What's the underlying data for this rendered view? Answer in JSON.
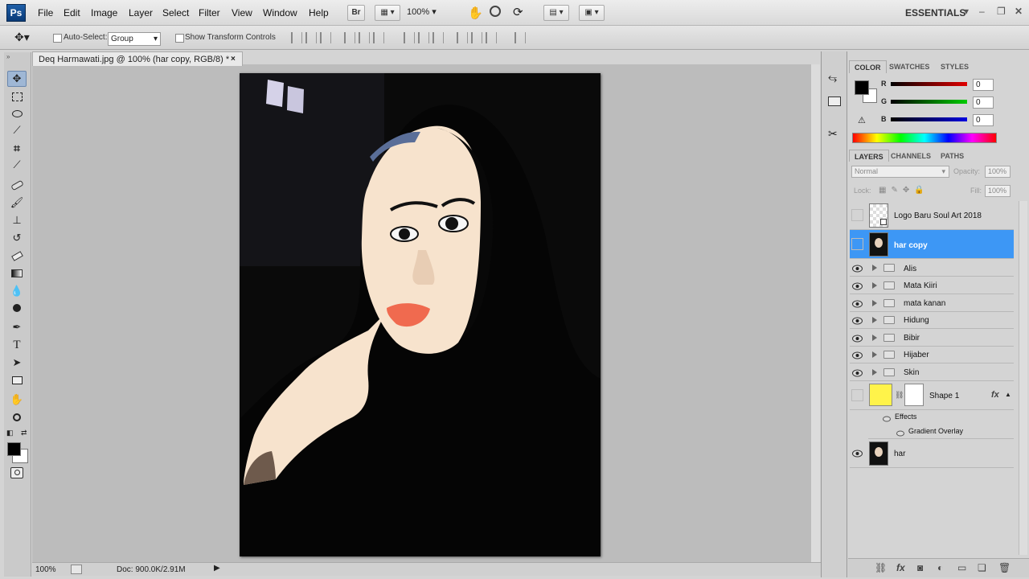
{
  "app": {
    "logo": "Ps",
    "menu": [
      "File",
      "Edit",
      "Image",
      "Layer",
      "Select",
      "Filter",
      "View",
      "Window",
      "Help"
    ],
    "bridge_label": "Br",
    "zoom": "100%",
    "workspace": "ESSENTIALS"
  },
  "options": {
    "auto_select_label": "Auto-Select:",
    "auto_select_value": "Group",
    "show_transform_label": "Show Transform Controls"
  },
  "document": {
    "tab_title": "Deq Harmawati.jpg @ 100% (har copy, RGB/8) *",
    "close": "×"
  },
  "status": {
    "zoom": "100%",
    "doc_size": "Doc: 900.0K/2.91M"
  },
  "color_panel": {
    "tabs": [
      "COLOR",
      "SWATCHES",
      "STYLES"
    ],
    "channels": [
      {
        "label": "R",
        "value": "0",
        "color": "#cc0000"
      },
      {
        "label": "G",
        "value": "0",
        "color": "#00aa00"
      },
      {
        "label": "B",
        "value": "0",
        "color": "#0000cc"
      }
    ],
    "foreground": "#000000",
    "background": "#ffffff"
  },
  "layers_panel": {
    "tabs": [
      "LAYERS",
      "CHANNELS",
      "PATHS"
    ],
    "blend_mode": "Normal",
    "opacity_label": "Opacity:",
    "opacity": "100%",
    "lock_label": "Lock:",
    "fill_label": "Fill:",
    "fill": "100%",
    "layers": [
      {
        "name": "Logo Baru Soul Art 2018",
        "type": "smart",
        "visible": false
      },
      {
        "name": "har copy",
        "type": "photo",
        "visible": false,
        "selected": true
      },
      {
        "name": "Alis",
        "type": "group",
        "visible": true
      },
      {
        "name": "Mata Kiiri",
        "type": "group",
        "visible": true
      },
      {
        "name": "mata kanan",
        "type": "group",
        "visible": true
      },
      {
        "name": "Hidung",
        "type": "group",
        "visible": true
      },
      {
        "name": "Bibir",
        "type": "group",
        "visible": true
      },
      {
        "name": "Hijaber",
        "type": "group",
        "visible": true
      },
      {
        "name": "Skin",
        "type": "group",
        "visible": true
      },
      {
        "name": "Shape 1",
        "type": "shape",
        "visible": false
      },
      {
        "name": "har",
        "type": "photo",
        "visible": true
      }
    ],
    "effects_label": "Effects",
    "gradient_overlay": "Gradient Overlay",
    "fx": "fx",
    "selection_color": "#3d97f5"
  }
}
